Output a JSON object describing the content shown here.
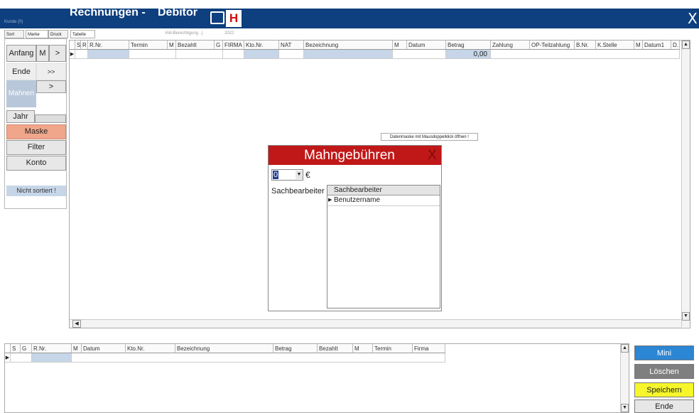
{
  "titlebar": {
    "small": "Kunde (0)",
    "title1": "Rechnungen -",
    "title2": "Debitor",
    "h_label": "H",
    "close": "X"
  },
  "tabs": [
    "Sort",
    "Marke",
    "Druck",
    "Tabelle"
  ],
  "faint": {
    "info": "Voll-Berechtigung ..|",
    "year": "2022"
  },
  "left": {
    "anfang": "Anfang",
    "m": "M",
    "gt": ">",
    "ende": "Ende",
    "gtgt": ">>",
    "mahnen": "Mahnen",
    "gt2": ">",
    "jahr": "Jahr",
    "maske": "Maske",
    "filter": "Filter",
    "konto": "Konto",
    "nicht": "Nicht sortiert !"
  },
  "grid": {
    "headers": [
      "S",
      "R",
      "R.Nr.",
      "Termin",
      "M",
      "Bezahlt",
      "G",
      "FIRMA",
      "Kto.Nr.",
      "NAT",
      "Bezeichnung",
      "M",
      "Datum",
      "Betrag",
      "Zahlung",
      "OP-Teilzahlung",
      "B.Nr.",
      "K.Stelle",
      "M",
      "Datum1",
      "D."
    ],
    "betrag_value": "0,00"
  },
  "hint": "Datenmaske mit Mausdoppelklick öffnen !",
  "dialog": {
    "title": "Mahngebühren",
    "close": "X",
    "amount": "0",
    "currency": "€",
    "label": "Sachbearbeiter",
    "col_header": "Sachbearbeiter",
    "row": "Benutzername"
  },
  "bottom_grid": {
    "headers": [
      "S",
      "G",
      "R.Nr.",
      "M",
      "Datum",
      "Kto.Nr.",
      "Bezeichnung",
      "Betrag",
      "Bezahlt",
      "M",
      "Termin",
      "Firma"
    ]
  },
  "right_buttons": {
    "mini": "Mini",
    "loeschen": "Löschen",
    "speichern": "Speichern",
    "ende": "Ende"
  },
  "colors": {
    "titlebar": "#0e3f7e",
    "dialog_header": "#c01818",
    "maske": "#f0a68a",
    "mini": "#2b86d4",
    "loeschen": "#7f7f7f",
    "speichern": "#f6f62b",
    "highlight": "#c6d6e8"
  }
}
